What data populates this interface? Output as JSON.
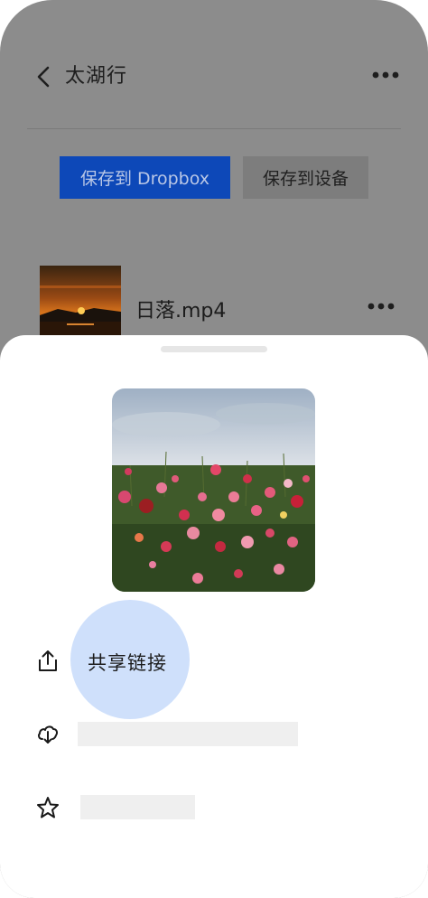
{
  "header": {
    "title": "太湖行",
    "back_icon": "chevron-left-icon",
    "more_icon": "more-horizontal-icon"
  },
  "buttons": {
    "save_dropbox": "保存到 Dropbox",
    "save_device": "保存到设备"
  },
  "file": {
    "name": "日落.mp4",
    "thumbnail": "sunset-image",
    "more_icon": "more-horizontal-icon"
  },
  "sheet": {
    "preview": "flower-field-image",
    "actions": [
      {
        "label": "共享链接",
        "icon": "share-upload-icon"
      },
      {
        "label": "",
        "icon": "download-cloud-icon"
      },
      {
        "label": "",
        "icon": "star-icon"
      }
    ]
  },
  "colors": {
    "overlay": "#8c8c8c",
    "dropbox_blue": "#0d48b8",
    "share_highlight": "#cfe0fb",
    "sheet_bg": "#ffffff"
  }
}
